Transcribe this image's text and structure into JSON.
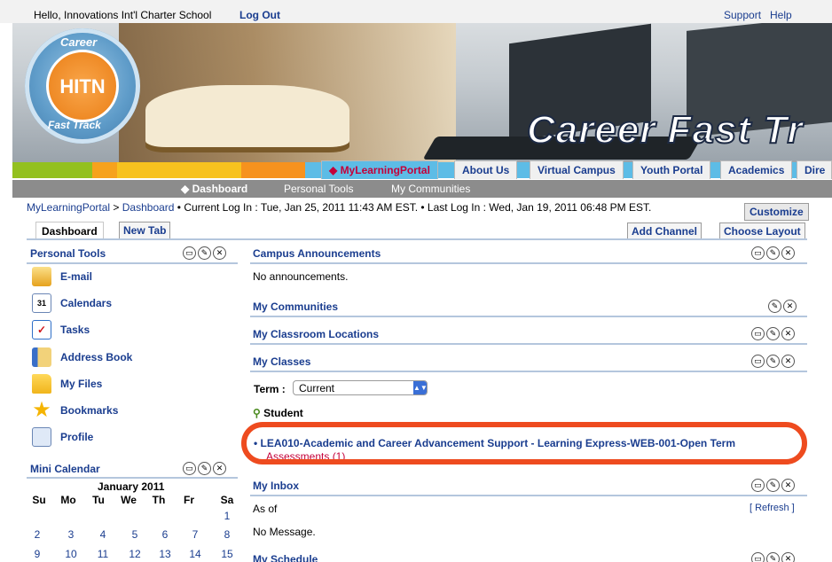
{
  "topbar": {
    "greeting": "Hello, Innovations Int'l Charter School",
    "logout": "Log Out",
    "support": "Support",
    "help": "Help"
  },
  "banner": {
    "brand_text": "Career Fast Tr",
    "logo_top": "Career",
    "logo_center": "HITN",
    "logo_bottom": "Fast Track"
  },
  "main_tabs": [
    {
      "label": "◆ MyLearningPortal",
      "active": true
    },
    {
      "label": "About Us",
      "active": false
    },
    {
      "label": "Virtual Campus",
      "active": false
    },
    {
      "label": "Youth Portal",
      "active": false
    },
    {
      "label": "Academics",
      "active": false
    },
    {
      "label": "Dire",
      "active": false
    }
  ],
  "sub_nav": [
    {
      "label": "◆ Dashboard",
      "active": true
    },
    {
      "label": "Personal Tools",
      "active": false
    },
    {
      "label": "My Communities",
      "active": false
    }
  ],
  "breadcrumb": {
    "root": "MyLearningPortal",
    "sep": " > ",
    "current": "Dashboard",
    "login_info": " • Current Log In : Tue, Jan 25, 2011 11:43 AM EST.   • Last Log In : Wed, Jan 19, 2011 06:48 PM EST."
  },
  "customize": "Customize",
  "page_tabs": {
    "dashboard": "Dashboard",
    "new_tab": "New Tab"
  },
  "channel_buttons": {
    "add": "Add Channel",
    "layout": "Choose Layout"
  },
  "personal_tools": {
    "title": "Personal Tools",
    "items": [
      "E-mail",
      "Calendars",
      "Tasks",
      "Address Book",
      "My Files",
      "Bookmarks",
      "Profile"
    ]
  },
  "mini_calendar": {
    "title": "Mini Calendar",
    "month": "January 2011",
    "days": [
      "Su",
      "Mo",
      "Tu",
      "We",
      "Th",
      "Fr",
      "Sa"
    ],
    "rows": [
      [
        "",
        "",
        "",
        "",
        "",
        "",
        "1"
      ],
      [
        "2",
        "3",
        "4",
        "5",
        "6",
        "7",
        "8"
      ],
      [
        "9",
        "10",
        "11",
        "12",
        "13",
        "14",
        "15"
      ]
    ]
  },
  "channels": {
    "announcements_title": "Campus Announcements",
    "announcements_body": "No announcements.",
    "communities_title": "My Communities",
    "classroom_title": "My Classroom Locations",
    "classes_title": "My Classes",
    "term_label": "Term :",
    "term_value": "Current",
    "student_label": "Student",
    "course_link": "LEA010-Academic and Career Advancement Support - Learning Express-WEB-001-Open Term",
    "assessments": "Assessments (1)",
    "inbox_title": "My Inbox",
    "inbox_as_of": "As of",
    "inbox_refresh": "[ Refresh ]",
    "inbox_body": "No Message.",
    "schedule_title": "My Schedule"
  },
  "colors": {
    "link": "#1a3d8f",
    "active_tab": "#5dbce6",
    "subnav": "#8c8c8c",
    "highlight": "#ee4b1f"
  }
}
